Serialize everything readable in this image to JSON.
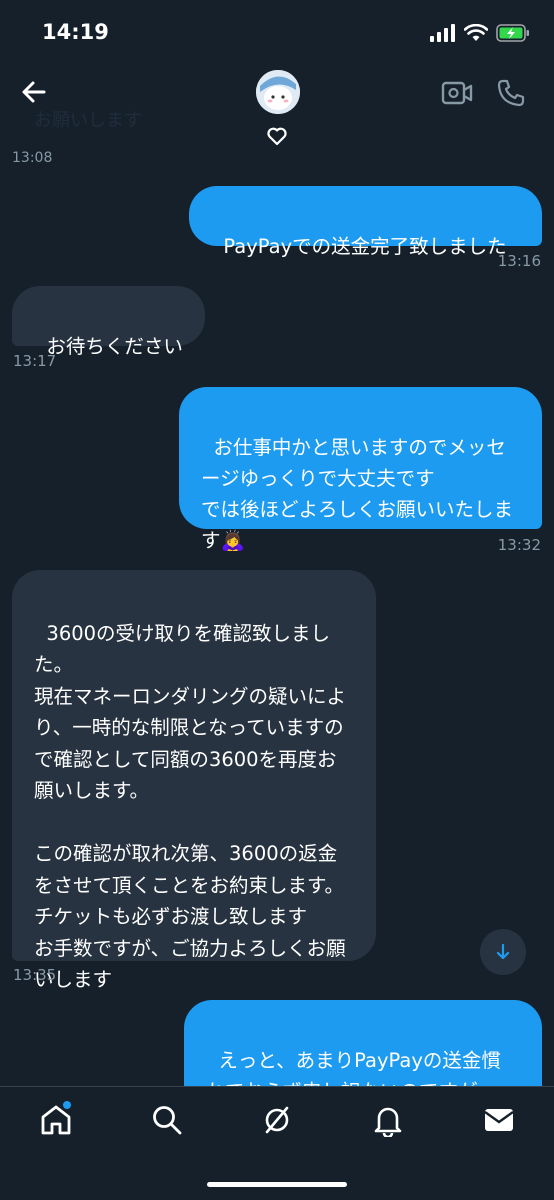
{
  "status": {
    "time": "14:19"
  },
  "header": {
    "ghost_text": "お願いします"
  },
  "cut_timestamp": "13:08",
  "messages": [
    {
      "dir": "out",
      "text": "PayPayでの送金完了致しました",
      "time": "13:16"
    },
    {
      "dir": "in",
      "text": "お待ちください",
      "time": "13:17"
    },
    {
      "dir": "out",
      "text": "お仕事中かと思いますのでメッセージゆっくりで大丈夫です\nでは後ほどよろしくお願いいたします🙇‍♀️",
      "time": "13:32"
    },
    {
      "dir": "in",
      "text": "3600の受け取りを確認致しました。\n現在マネーロンダリングの疑いにより、一時的な制限となっていますので確認として同額の3600を再度お願いします。\n\nこの確認が取れ次第、3600の返金をさせて頂くことをお約束します。\nチケットも必ずお渡し致します\nお手数ですが、ご協力よろしくお願いします",
      "time": "13:35"
    },
    {
      "dir": "out",
      "text": "えっと、あまりPayPayの送金慣れておらず申し訳ないのですが",
      "time": ""
    }
  ],
  "colors": {
    "background": "#15202b",
    "outgoing_bubble": "#1d9bf0",
    "incoming_bubble": "#273340",
    "timestamp": "#8899a6"
  }
}
